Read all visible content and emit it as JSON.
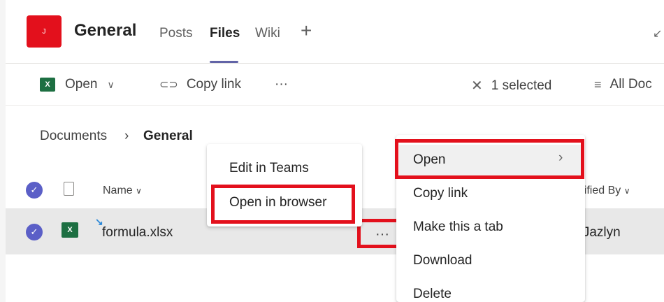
{
  "header": {
    "team_avatar_initial": "J",
    "channel_name": "General",
    "tabs": [
      {
        "label": "Posts"
      },
      {
        "label": "Files"
      },
      {
        "label": "Wiki"
      }
    ],
    "add_tab_symbol": "+"
  },
  "toolbar": {
    "open_label": "Open",
    "copy_link_label": "Copy link",
    "more_label": "···",
    "selection_label": "1 selected",
    "view_label": "All Doc"
  },
  "breadcrumb": {
    "root": "Documents",
    "separator": "›",
    "current": "General"
  },
  "file_list": {
    "columns": {
      "name": "Name",
      "modified_by": "odified By"
    },
    "rows": [
      {
        "name": "formula.xlsx",
        "modified_by": "u Jazlyn",
        "more": "···"
      }
    ]
  },
  "open_submenu": {
    "items": [
      {
        "label": "Edit in Teams"
      },
      {
        "label": "Open in browser"
      }
    ]
  },
  "context_menu": {
    "items": [
      {
        "label": "Open"
      },
      {
        "label": "Copy link"
      },
      {
        "label": "Make this a tab"
      },
      {
        "label": "Download"
      },
      {
        "label": "Delete"
      }
    ]
  },
  "colors": {
    "accent": "#5b5fc7",
    "highlight": "#e3101c",
    "excel": "#1d6f42"
  }
}
